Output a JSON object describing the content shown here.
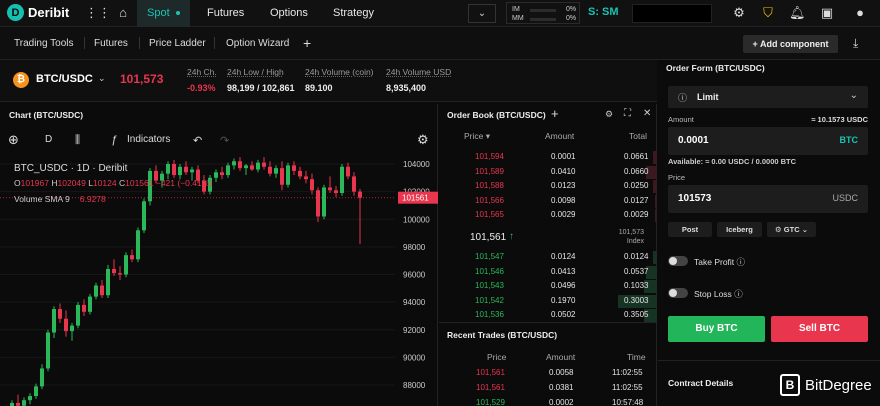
{
  "topnav": {
    "logo": "Deribit",
    "tabs": [
      "Spot",
      "Futures",
      "Options",
      "Strategy"
    ],
    "margin": {
      "im_label": "IM",
      "im_pct": "0%",
      "mm_label": "MM",
      "mm_pct": "0%"
    },
    "subaccount": "S: SM",
    "icons": [
      "apps-grid-icon",
      "home-icon",
      "gear-icon",
      "shield-icon",
      "bell-icon",
      "wallet-icon",
      "user-icon"
    ]
  },
  "toolbar": {
    "items": [
      "Trading Tools",
      "Futures",
      "Price Ladder",
      "Option Wizard"
    ],
    "add_component": "+ Add component"
  },
  "ticker": {
    "pair": "BTC/USDC",
    "last_price": "101,573",
    "stats": [
      {
        "label": "24h Ch.",
        "value": "-0.93%"
      },
      {
        "label": "24h Low / High",
        "value": "98,199 / 102,861"
      },
      {
        "label": "24h Volume (coin)",
        "value": "89.100"
      },
      {
        "label": "24h Volume USD",
        "value": "8,935,400"
      }
    ]
  },
  "chart": {
    "title": "Chart (BTC/USDC)",
    "interval": "D",
    "indicators_label": "Indicators",
    "legend": "BTC_USDC · 1D · Deribit",
    "ohlc": {
      "o": "101967",
      "h": "102049",
      "l": "10124",
      "c": "101561",
      "change": "−421 (−0.41%)"
    },
    "volume": {
      "label": "Volume SMA 9",
      "value": "6.9278"
    },
    "last_price_tag": "101561",
    "chart_data": {
      "type": "candlestick",
      "y_ticks": [
        "104000",
        "102000",
        "100000",
        "98000",
        "96000",
        "94000",
        "92000",
        "90000",
        "88000"
      ],
      "ylim": [
        86500,
        105500
      ],
      "candles": [
        [
          86200,
          86500,
          85600,
          86100
        ],
        [
          86100,
          86900,
          85800,
          86700
        ],
        [
          86700,
          87300,
          86300,
          86500
        ],
        [
          86500,
          87100,
          86200,
          86900
        ],
        [
          86900,
          87400,
          86600,
          87200
        ],
        [
          87200,
          88100,
          87000,
          87900
        ],
        [
          87900,
          89500,
          87700,
          89200
        ],
        [
          89200,
          92000,
          89000,
          91800
        ],
        [
          91800,
          93700,
          91400,
          93500
        ],
        [
          93500,
          93900,
          92500,
          92800
        ],
        [
          92800,
          93400,
          91500,
          91900
        ],
        [
          91900,
          92500,
          91200,
          92300
        ],
        [
          92300,
          94000,
          92100,
          93800
        ],
        [
          93800,
          94200,
          93000,
          93300
        ],
        [
          93300,
          94600,
          93100,
          94400
        ],
        [
          94400,
          95400,
          94200,
          95200
        ],
        [
          95200,
          95600,
          94300,
          94500
        ],
        [
          94500,
          96700,
          94300,
          96400
        ],
        [
          96400,
          97100,
          95900,
          96100
        ],
        [
          96100,
          96600,
          95600,
          96000
        ],
        [
          96000,
          97600,
          95800,
          97400
        ],
        [
          97400,
          97800,
          96900,
          97100
        ],
        [
          97100,
          99400,
          96900,
          99200
        ],
        [
          99200,
          101500,
          99000,
          101300
        ],
        [
          101300,
          103700,
          101000,
          103500
        ],
        [
          103500,
          103900,
          102600,
          102800
        ],
        [
          102800,
          103500,
          102300,
          103300
        ],
        [
          103300,
          104200,
          102900,
          104000
        ],
        [
          104000,
          104300,
          103000,
          103200
        ],
        [
          103200,
          104000,
          102900,
          103800
        ],
        [
          103800,
          104200,
          103200,
          103400
        ],
        [
          103400,
          103800,
          102800,
          103600
        ],
        [
          103600,
          103900,
          102600,
          102800
        ],
        [
          102800,
          103200,
          101800,
          102000
        ],
        [
          102000,
          103200,
          101800,
          103000
        ],
        [
          103000,
          103600,
          102700,
          103400
        ],
        [
          103400,
          103800,
          102900,
          103200
        ],
        [
          103200,
          104100,
          103000,
          103900
        ],
        [
          103900,
          104400,
          103600,
          104200
        ],
        [
          104200,
          104500,
          103500,
          103700
        ],
        [
          103700,
          104000,
          103200,
          103900
        ],
        [
          103900,
          104200,
          103500,
          103600
        ],
        [
          103600,
          104300,
          103400,
          104100
        ],
        [
          104100,
          104500,
          103600,
          103800
        ],
        [
          103800,
          104200,
          103100,
          103300
        ],
        [
          103300,
          103900,
          103000,
          103700
        ],
        [
          103700,
          104200,
          102100,
          102500
        ],
        [
          102500,
          104100,
          102300,
          103900
        ],
        [
          103900,
          104200,
          103200,
          103500
        ],
        [
          103500,
          103800,
          102900,
          103100
        ],
        [
          103100,
          103500,
          102600,
          102900
        ],
        [
          102900,
          103300,
          101800,
          102100
        ],
        [
          102100,
          102300,
          99800,
          100200
        ],
        [
          100200,
          102500,
          100000,
          102300
        ],
        [
          102300,
          103100,
          101900,
          102100
        ],
        [
          102100,
          102400,
          101600,
          101900
        ],
        [
          101900,
          104000,
          101700,
          103800
        ],
        [
          103800,
          104100,
          102900,
          103100
        ],
        [
          103100,
          103400,
          101700,
          102000
        ],
        [
          102000,
          102200,
          98200,
          101561
        ]
      ]
    }
  },
  "orderbook": {
    "title": "Order Book (BTC/USDC)",
    "headers": [
      "Price",
      "Amount",
      "Total"
    ],
    "asks": [
      {
        "price": "101,594",
        "amount": "0.0001",
        "total": "0.0661",
        "depth": 0.02
      },
      {
        "price": "101,589",
        "amount": "0.0410",
        "total": "0.0660",
        "depth": 0.05
      },
      {
        "price": "101,588",
        "amount": "0.0123",
        "total": "0.0250",
        "depth": 0.02
      },
      {
        "price": "101,566",
        "amount": "0.0098",
        "total": "0.0127",
        "depth": 0.01
      },
      {
        "price": "101,565",
        "amount": "0.0029",
        "total": "0.0029",
        "depth": 0.01
      }
    ],
    "mid": {
      "price": "101,561",
      "index_value": "101,573",
      "index_label": "Index"
    },
    "bids": [
      {
        "price": "101,547",
        "amount": "0.0124",
        "total": "0.0124",
        "depth": 0.02
      },
      {
        "price": "101,546",
        "amount": "0.0413",
        "total": "0.0537",
        "depth": 0.05
      },
      {
        "price": "101,543",
        "amount": "0.0496",
        "total": "0.1033",
        "depth": 0.06
      },
      {
        "price": "101,542",
        "amount": "0.1970",
        "total": "0.3003",
        "depth": 0.18
      },
      {
        "price": "101,536",
        "amount": "0.0502",
        "total": "0.3505",
        "depth": 0.06
      }
    ]
  },
  "recent_trades": {
    "title": "Recent Trades (BTC/USDC)",
    "headers": [
      "Price",
      "Amount",
      "Time"
    ],
    "rows": [
      {
        "price": "101,561",
        "amount": "0.0058",
        "time": "11:02:55",
        "side": "sell"
      },
      {
        "price": "101,561",
        "amount": "0.0381",
        "time": "11:02:55",
        "side": "sell"
      },
      {
        "price": "101,529",
        "amount": "0.0002",
        "time": "10:57:48",
        "side": "buy"
      }
    ]
  },
  "orderform": {
    "title": "Order Form (BTC/USDC)",
    "order_type": "Limit",
    "amount_label": "Amount",
    "amount_hint": "≈ 10.1573 USDC",
    "amount_value": "0.0001",
    "amount_unit": "BTC",
    "available": "Available: ≈ 0.00 USDC / 0.0000 BTC",
    "price_label": "Price",
    "price_value": "101573",
    "price_unit": "USDC",
    "chips": [
      "Post",
      "Iceberg",
      "GTC"
    ],
    "take_profit": "Take Profit",
    "stop_loss": "Stop Loss",
    "buy_label": "Buy BTC",
    "sell_label": "Sell BTC",
    "contract_details": "Contract Details"
  },
  "watermark": {
    "mark": "B",
    "text": "BitDegree"
  }
}
